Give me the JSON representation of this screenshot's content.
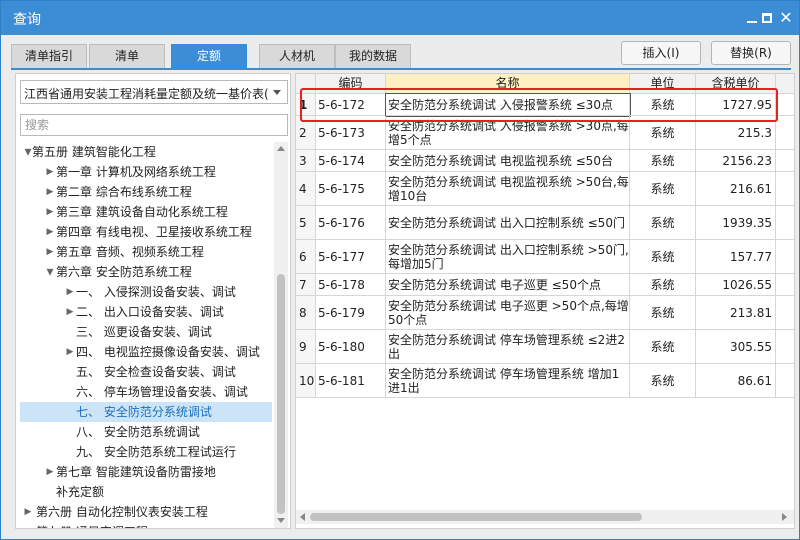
{
  "window": {
    "title": "查询"
  },
  "tabs": [
    "清单指引",
    "清单",
    "定额",
    "人材机",
    "我的数据"
  ],
  "active_tab": 2,
  "buttons": {
    "insert": "插入(I)",
    "replace": "替换(R)"
  },
  "left": {
    "select_value": "江西省通用安装工程消耗量定额及统一基价表(",
    "search_placeholder": "搜索",
    "tree": [
      {
        "label": "第五册  建筑智能化工程",
        "toggle": "▲"
      },
      {
        "label": "第一章  计算机及网络系统工程",
        "toggle": "▶"
      },
      {
        "label": "第二章  综合布线系统工程",
        "toggle": "▶"
      },
      {
        "label": "第三章  建筑设备自动化系统工程",
        "toggle": "▶"
      },
      {
        "label": "第四章  有线电视、卫星接收系统工程",
        "toggle": "▶"
      },
      {
        "label": "第五章  音频、视频系统工程",
        "toggle": "▶"
      },
      {
        "label": "第六章  安全防范系统工程",
        "toggle": "▲"
      },
      {
        "label": "一、  入侵探测设备安装、调试",
        "toggle": "▶"
      },
      {
        "label": "二、  出入口设备安装、调试",
        "toggle": "▶"
      },
      {
        "label": "三、  巡更设备安装、调试",
        "toggle": ""
      },
      {
        "label": "四、  电视监控摄像设备安装、调试",
        "toggle": "▶"
      },
      {
        "label": "五、  安全检查设备安装、调试",
        "toggle": ""
      },
      {
        "label": "六、  停车场管理设备安装、调试",
        "toggle": ""
      },
      {
        "label": "七、  安全防范分系统调试",
        "toggle": ""
      },
      {
        "label": "八、  安全防范系统调试",
        "toggle": ""
      },
      {
        "label": "九、  安全防范系统工程试运行",
        "toggle": ""
      },
      {
        "label": "第七章  智能建筑设备防雷接地",
        "toggle": "▶"
      },
      {
        "label": "补充定额",
        "toggle": ""
      },
      {
        "label": "第六册  自动化控制仪表安装工程",
        "toggle": "▶"
      },
      {
        "label": "第七册  通风空调工程",
        "toggle": ""
      }
    ],
    "selected_index": 13
  },
  "table": {
    "headers": [
      "",
      "编码",
      "名称",
      "单位",
      "含税单价"
    ],
    "rows": [
      {
        "idx": "1",
        "code": "5-6-172",
        "name": "安全防范分系统调试 入侵报警系统 ≤30点",
        "unit": "系统",
        "price": "1727.95"
      },
      {
        "idx": "2",
        "code": "5-6-173",
        "name": "安全防范分系统调试 入侵报警系统 >30点,每增5个点",
        "unit": "系统",
        "price": "215.3"
      },
      {
        "idx": "3",
        "code": "5-6-174",
        "name": "安全防范分系统调试 电视监视系统 ≤50台",
        "unit": "系统",
        "price": "2156.23"
      },
      {
        "idx": "4",
        "code": "5-6-175",
        "name": "安全防范分系统调试 电视监视系统 >50台,每增10台",
        "unit": "系统",
        "price": "216.61"
      },
      {
        "idx": "5",
        "code": "5-6-176",
        "name": "安全防范分系统调试 出入口控制系统 ≤50门",
        "unit": "系统",
        "price": "1939.35"
      },
      {
        "idx": "6",
        "code": "5-6-177",
        "name": "安全防范分系统调试 出入口控制系统 >50门,每增加5门",
        "unit": "系统",
        "price": "157.77"
      },
      {
        "idx": "7",
        "code": "5-6-178",
        "name": "安全防范分系统调试 电子巡更 ≤50个点",
        "unit": "系统",
        "price": "1026.55"
      },
      {
        "idx": "8",
        "code": "5-6-179",
        "name": "安全防范分系统调试 电子巡更 >50个点,每增50个点",
        "unit": "系统",
        "price": "213.81"
      },
      {
        "idx": "9",
        "code": "5-6-180",
        "name": "安全防范分系统调试 停车场管理系统 ≤2进2出",
        "unit": "系统",
        "price": "305.55"
      },
      {
        "idx": "10",
        "code": "5-6-181",
        "name": "安全防范分系统调试 停车场管理系统 增加1进1出",
        "unit": "系统",
        "price": "86.61"
      }
    ]
  },
  "colors": {
    "accent": "#3b8ed6",
    "highlight": "#e52222",
    "selected_bg": "#cce4f7"
  }
}
